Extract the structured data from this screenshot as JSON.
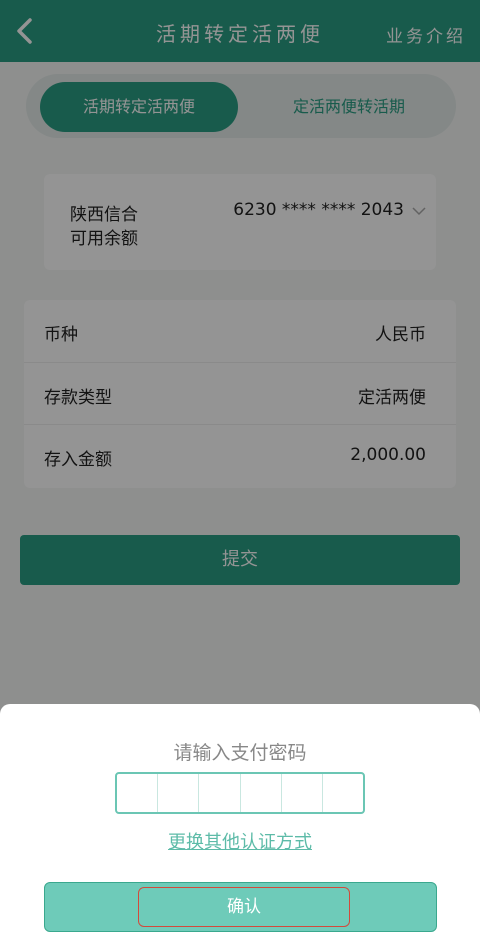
{
  "header": {
    "title": "活期转定活两便",
    "link": "业务介绍"
  },
  "tabs": [
    {
      "label": "活期转定活两便",
      "active": true
    },
    {
      "label": "定活两便转活期",
      "active": false
    }
  ],
  "account": {
    "bank": "陕西信合",
    "balance_label": "可用余额",
    "number": "6230 **** **** 2043"
  },
  "form": {
    "rows": [
      {
        "label": "币种",
        "value": "人民币"
      },
      {
        "label": "存款类型",
        "value": "定活两便"
      },
      {
        "label": "存入金额",
        "value": "2,000.00"
      }
    ]
  },
  "submit_label": "提交",
  "sheet": {
    "title": "请输入支付密码",
    "alt_link": "更换其他认证方式",
    "confirm_label": "确认"
  },
  "colors": {
    "primary": "#2a9d83",
    "light": "#6ecbb9"
  },
  "icons": {
    "back": "back-arrow-icon",
    "chevron": "chevron-down-icon"
  }
}
